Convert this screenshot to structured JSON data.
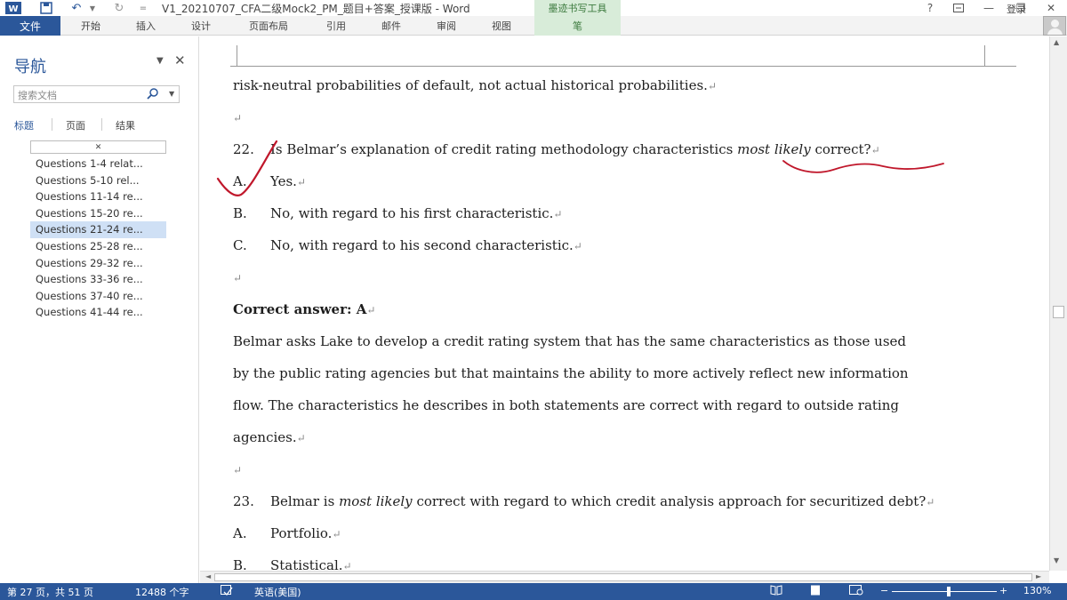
{
  "titlebar": {
    "doc_title": "V1_20210707_CFA二级Mock2_PM_题目+答案_授课版 - Word",
    "ink_tools_title": "墨迹书写工具",
    "help": "?",
    "min": "—",
    "restore": "❐",
    "close": "✕",
    "undo": "↶",
    "redo": "↻",
    "qa_more": "="
  },
  "ribbon": {
    "file": "文件",
    "tabs": [
      "开始",
      "插入",
      "设计",
      "页面布局",
      "引用",
      "邮件",
      "审阅",
      "视图"
    ],
    "pen": "笔",
    "signin": "登录"
  },
  "nav": {
    "title": "导航",
    "search_placeholder": "搜索文档",
    "tabs": [
      "标题",
      "页面",
      "结果"
    ],
    "collapse": "◄",
    "items": [
      "Questions 1-4 relat...",
      "Questions 5-10 rel...",
      "Questions 11-14 re...",
      "Questions 15-20 re...",
      "Questions 21-24 re...",
      "Questions 25-28 re...",
      "Questions 29-32 re...",
      "Questions 33-36 re...",
      "Questions 37-40 re...",
      "Questions 41-44 re..."
    ],
    "selected_index": 4
  },
  "document": {
    "line1": "risk-neutral probabilities of default, not actual historical probabilities.",
    "q22": {
      "num": "22.",
      "text_pre": "Is Belmar’s explanation of credit rating methodology characteristics ",
      "text_em": "most likely",
      "text_post": " correct?",
      "options": [
        {
          "letter": "A.",
          "text": "Yes."
        },
        {
          "letter": "B.",
          "text": "No, with regard to his first characteristic."
        },
        {
          "letter": "C.",
          "text": "No, with regard to his second characteristic."
        }
      ]
    },
    "answer_label": "Correct answer: A",
    "explanation": [
      "Belmar asks Lake to develop a credit rating system that has the same characteristics as those used",
      "by the public rating agencies but that maintains the ability to more actively reflect new information",
      "flow. The characteristics he describes in both statements are correct with regard to outside rating",
      "agencies."
    ],
    "q23": {
      "num": "23.",
      "text_pre": "Belmar is ",
      "text_em": "most likely",
      "text_post": " correct with regard to which credit analysis approach for securitized debt?",
      "options": [
        {
          "letter": "A.",
          "text": "Portfolio."
        },
        {
          "letter": "B.",
          "text": "Statistical."
        }
      ]
    },
    "para_mark": "↵"
  },
  "statusbar": {
    "page": "第 27 页，共 51 页",
    "words": "12488 个字",
    "lang": "英语(美国)",
    "zoom": "130%"
  },
  "colors": {
    "accent": "#2b579a",
    "ink": "#c0172b",
    "ink_tools_bg": "#d8ecd9"
  }
}
